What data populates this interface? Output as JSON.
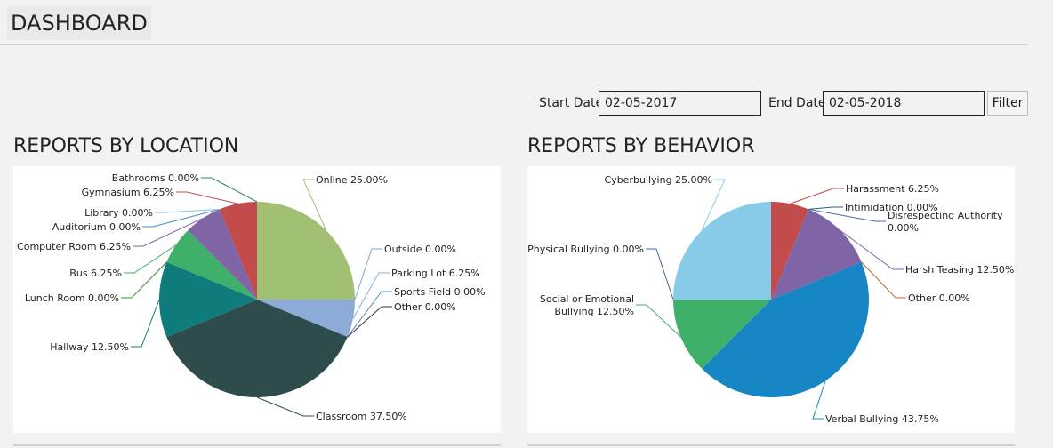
{
  "header": {
    "title": "DASHBOARD"
  },
  "filters": {
    "start_label": "Start Date",
    "start_value": "02-05-2017",
    "end_label": "End Date",
    "end_value": "02-05-2018",
    "filter_label": "Filter"
  },
  "chart_data": [
    {
      "type": "pie",
      "title": "REPORTS BY LOCATION",
      "slices": [
        {
          "label": "Online 25.00%",
          "value": 25.0,
          "color": "#a2c074"
        },
        {
          "label": "Outside 0.00%",
          "value": 0.0,
          "color": "#7aa6d6"
        },
        {
          "label": "Parking Lot 6.25%",
          "value": 6.25,
          "color": "#8eaad7"
        },
        {
          "label": "Sports Field 0.00%",
          "value": 0.0,
          "color": "#4a90c8"
        },
        {
          "label": "Other 0.00%",
          "value": 0.0,
          "color": "#333333"
        },
        {
          "label": "Classroom 37.50%",
          "value": 37.5,
          "color": "#2e4c4c"
        },
        {
          "label": "Hallway 12.50%",
          "value": 12.5,
          "color": "#0f7b7a"
        },
        {
          "label": "Lunch Room 0.00%",
          "value": 0.0,
          "color": "#3a8f3a"
        },
        {
          "label": "Bus 6.25%",
          "value": 6.25,
          "color": "#3fb06a"
        },
        {
          "label": "Computer Room 6.25%",
          "value": 6.25,
          "color": "#7f64a6"
        },
        {
          "label": "Auditorium 0.00%",
          "value": 0.0,
          "color": "#4a8ac4"
        },
        {
          "label": "Library 0.00%",
          "value": 0.0,
          "color": "#7ac6e0"
        },
        {
          "label": "Gymnasium 6.25%",
          "value": 6.25,
          "color": "#c24b4b"
        },
        {
          "label": "Bathrooms 0.00%",
          "value": 0.0,
          "color": "#2a8a5a"
        }
      ]
    },
    {
      "type": "pie",
      "title": "REPORTS BY BEHAVIOR",
      "slices": [
        {
          "label": "Harassment 6.25%",
          "value": 6.25,
          "color": "#c24b4b"
        },
        {
          "label": "Intimidation 0.00%",
          "value": 0.0,
          "color": "#2a5a8a"
        },
        {
          "label": "Disrespecting Authority 0.00%",
          "value": 0.0,
          "color": "#4a6ab4"
        },
        {
          "label": "Harsh Teasing 12.50%",
          "value": 12.5,
          "color": "#7f64a6"
        },
        {
          "label": "Other 0.00%",
          "value": 0.0,
          "color": "#c06a2a"
        },
        {
          "label": "Verbal Bullying 43.75%",
          "value": 43.75,
          "color": "#1686c4"
        },
        {
          "label": "Social or Emotional Bullying 12.50%",
          "value": 12.5,
          "color": "#3fb06a"
        },
        {
          "label": "Physical Bullying 0.00%",
          "value": 0.0,
          "color": "#3a6aa0"
        },
        {
          "label": "Cyberbullying 25.00%",
          "value": 25.0,
          "color": "#87cbe8"
        }
      ]
    }
  ]
}
